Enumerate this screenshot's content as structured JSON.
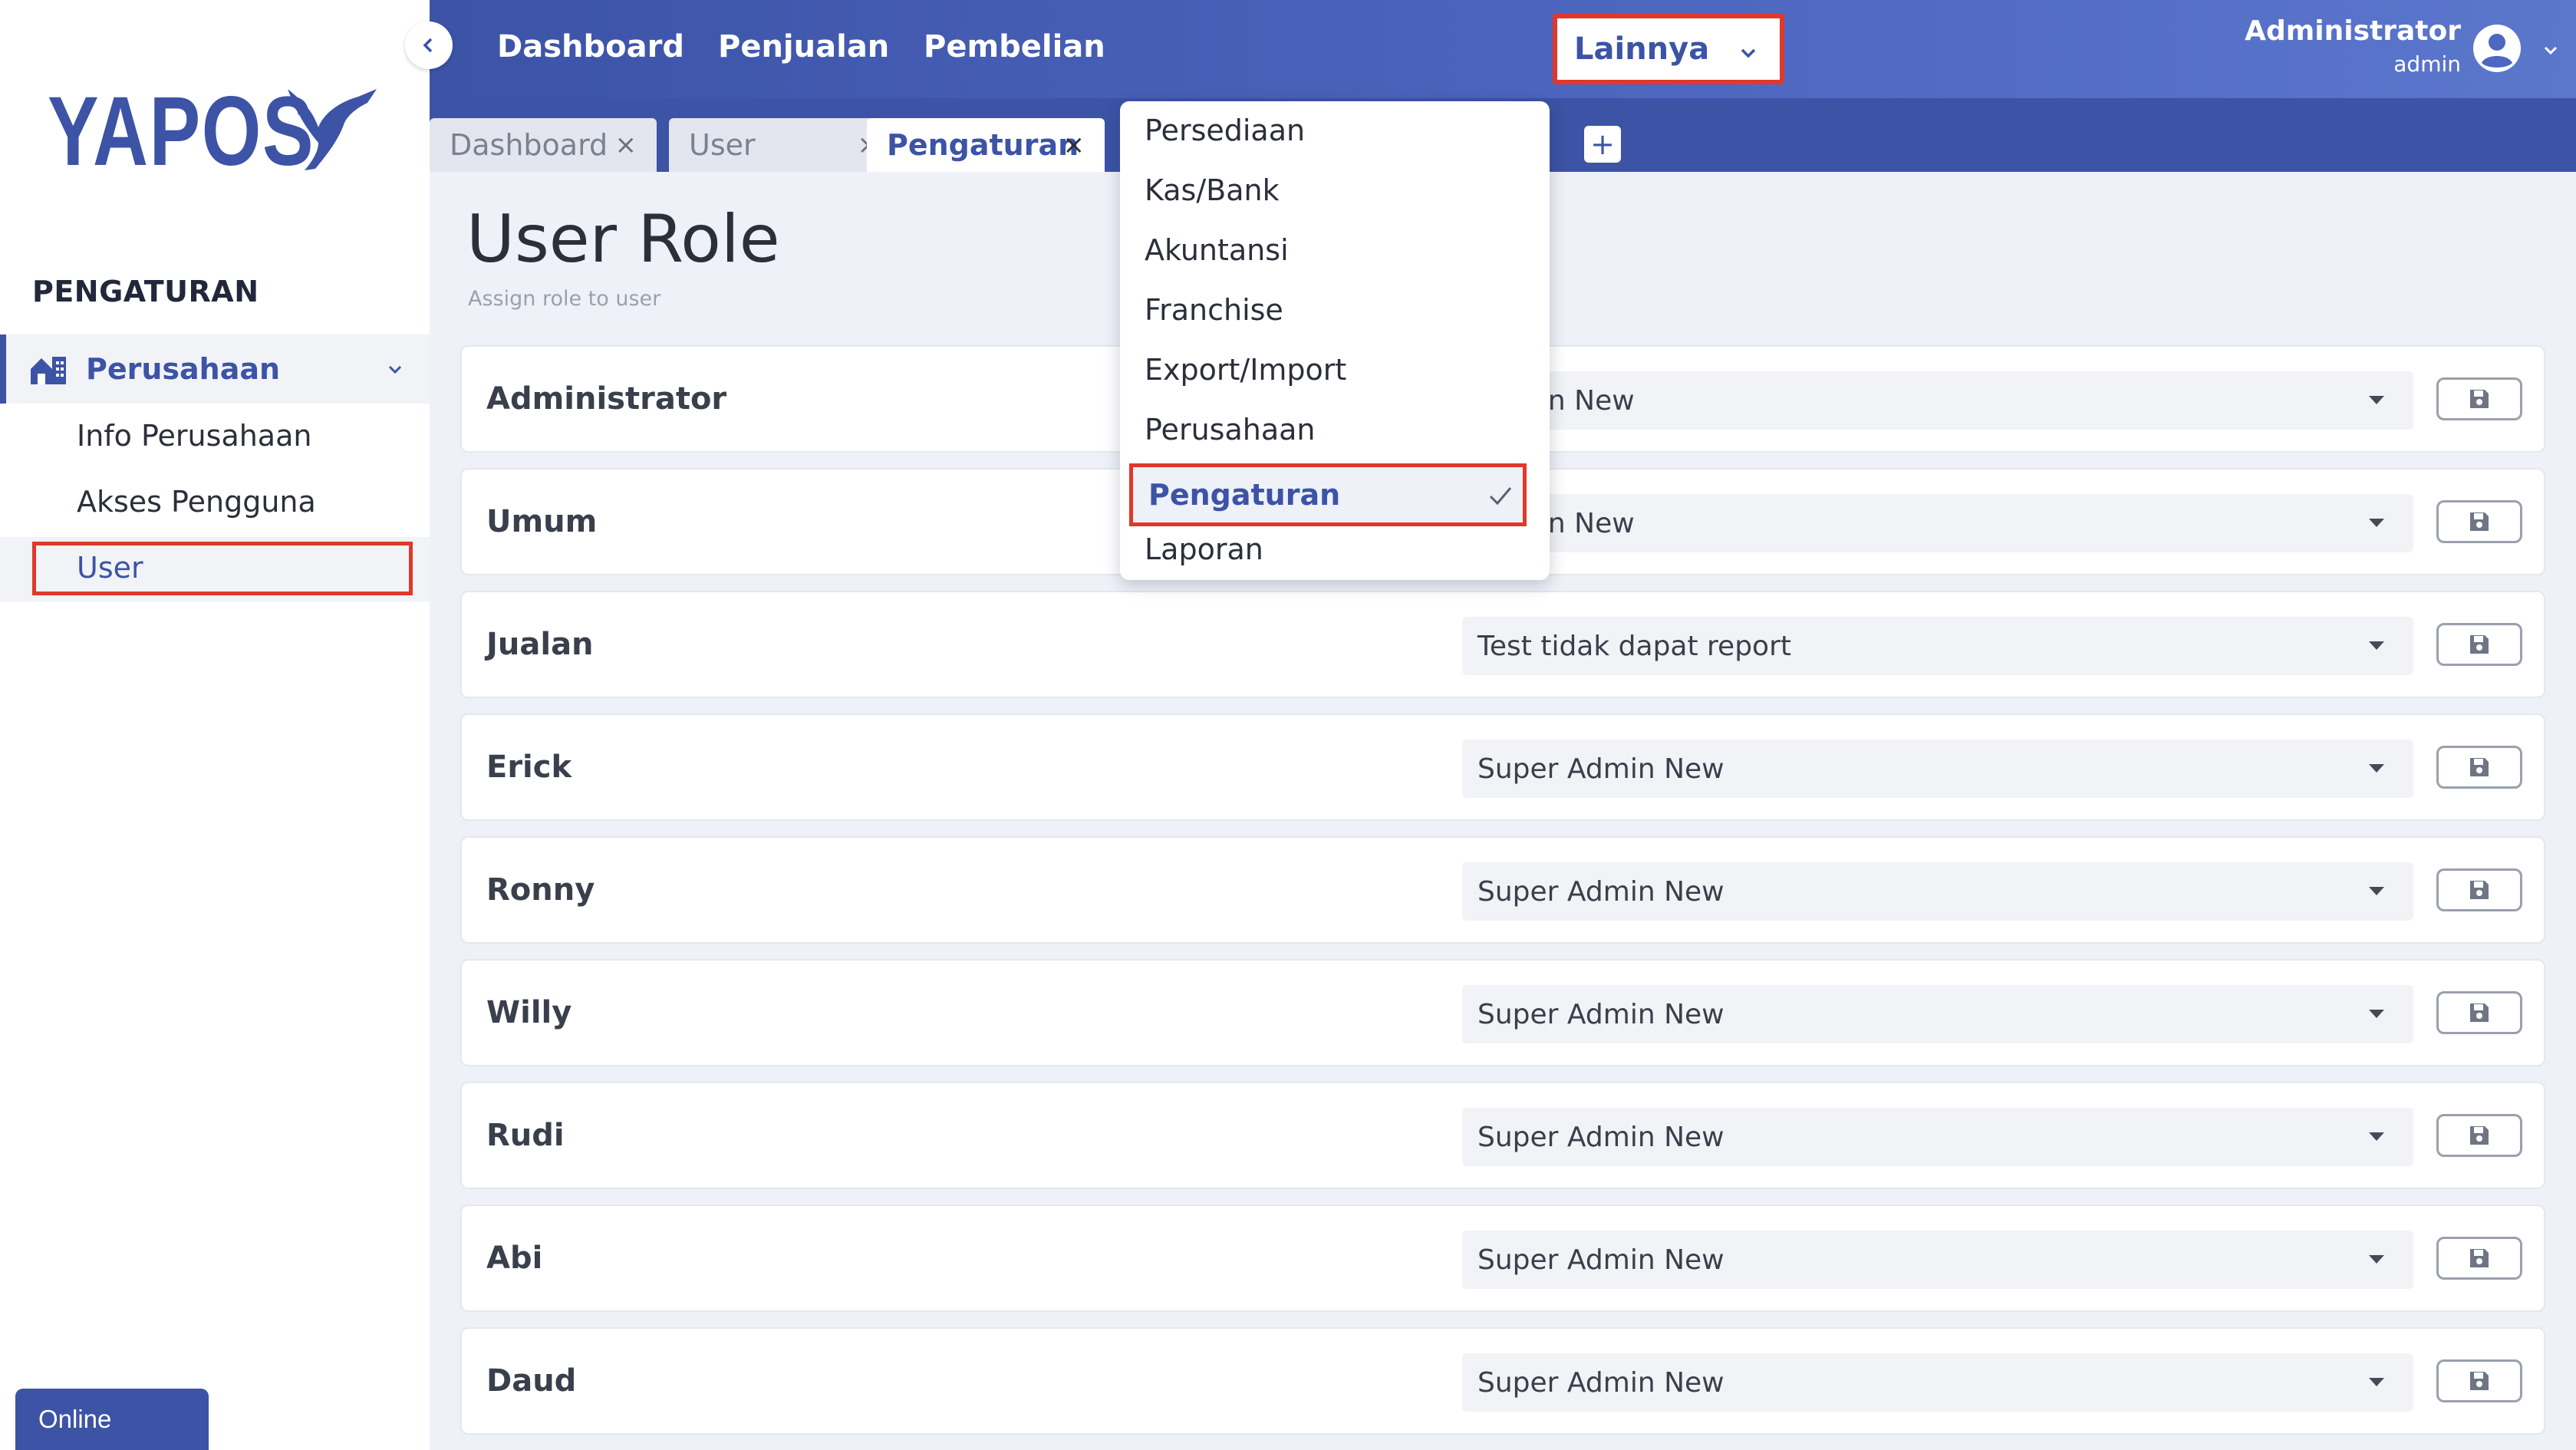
{
  "brand": {
    "logo_text": "YAPOS"
  },
  "sidebar": {
    "section_title": "PENGATURAN",
    "group": {
      "label": "Perusahaan",
      "icon": "building-icon"
    },
    "items": [
      {
        "label": "Info Perusahaan"
      },
      {
        "label": "Akses Pengguna"
      },
      {
        "label": "User",
        "active": true
      }
    ],
    "status": "Online"
  },
  "topnav": {
    "items": [
      {
        "label": "Dashboard"
      },
      {
        "label": "Penjualan"
      },
      {
        "label": "Pembelian"
      }
    ],
    "more_label": "Lainnya",
    "user": {
      "name": "Administrator",
      "role": "admin"
    }
  },
  "tabs": [
    {
      "label": "Dashboard",
      "close": "×",
      "active": false
    },
    {
      "label": "User",
      "close": "×",
      "active": false
    },
    {
      "label": "Pengaturan",
      "close": "×",
      "active": true
    }
  ],
  "tab_add": "+",
  "dropdown": {
    "items": [
      "Persediaan",
      "Kas/Bank",
      "Akuntansi",
      "Franchise",
      "Export/Import",
      "Perusahaan",
      "Pengaturan",
      "Laporan"
    ],
    "selected": "Pengaturan"
  },
  "page": {
    "title": "User Role",
    "subtitle": "Assign role to user"
  },
  "users": [
    {
      "name": "Administrator",
      "role": "Admin New"
    },
    {
      "name": "Umum",
      "role": "Admin New"
    },
    {
      "name": "Jualan",
      "role": "Test tidak dapat report"
    },
    {
      "name": "Erick",
      "role": "Super Admin New"
    },
    {
      "name": "Ronny",
      "role": "Super Admin New"
    },
    {
      "name": "Willy",
      "role": "Super Admin New"
    },
    {
      "name": "Rudi",
      "role": "Super Admin New"
    },
    {
      "name": "Abi",
      "role": "Super Admin New"
    },
    {
      "name": "Daud",
      "role": "Super Admin New"
    }
  ],
  "colors": {
    "primary": "#3c53a6",
    "highlight": "#e0382b",
    "background": "#eef1f7"
  }
}
